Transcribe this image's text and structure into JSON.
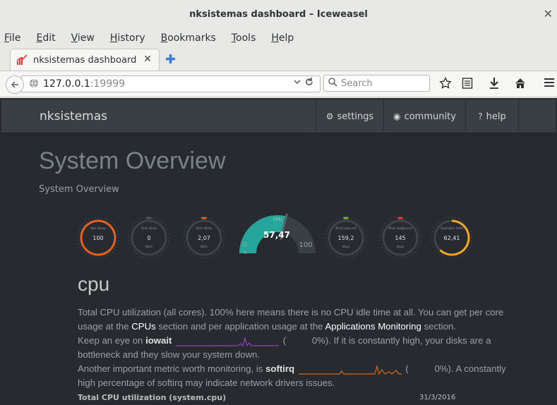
{
  "window": {
    "title": "nksistemas dashboard – Iceweasel",
    "close": "✕"
  },
  "menu": [
    "File",
    "Edit",
    "View",
    "History",
    "Bookmarks",
    "Tools",
    "Help"
  ],
  "tab": {
    "label": "nksistemas dashboard",
    "close": "✕",
    "new_tab": "✚"
  },
  "navbar": {
    "url_host": "127.0.0.1",
    "url_port": ":19999",
    "search_placeholder": "Search"
  },
  "site": {
    "brand": "nksistemas",
    "links": [
      {
        "icon": "⚙",
        "label": "settings"
      },
      {
        "icon": "◉",
        "label": "community"
      },
      {
        "icon": "?",
        "label": "help"
      }
    ]
  },
  "overview": {
    "title": "System Overview",
    "subtitle": "System Overview"
  },
  "gauges": {
    "small": [
      {
        "title": "Net Swap",
        "value": "100",
        "unit": "",
        "color": "#e8601c",
        "level": 1.0
      },
      {
        "title": "Disk Read",
        "value": "0",
        "unit": "KB/s",
        "color": "#555555",
        "level": 0.0
      },
      {
        "title": "Disk Write",
        "value": "2,07",
        "unit": "KB/s",
        "color": "#e8601c",
        "level": 0.03
      },
      {
        "title": "IPv4 Inbound",
        "value": "159,2",
        "unit": "kbps",
        "color": "#7cb342",
        "level": 0.05
      },
      {
        "title": "IPv4 Outbound",
        "value": "145",
        "unit": "kbps",
        "color": "#e53935",
        "level": 0.08
      },
      {
        "title": "Available RAM",
        "value": "62,41",
        "unit": "",
        "color": "#f5a623",
        "level": 0.62
      }
    ],
    "cpu": {
      "title": "CPU",
      "value": "57,47",
      "min": "0",
      "max": "100",
      "unit": "%",
      "color": "#26a69a",
      "level": 0.5747
    }
  },
  "cpu_section": {
    "title": "cpu",
    "p1": "Total CPU utilization (all cores). 100% here means there is no CPU idle time at all. You can get per core usage at the ",
    "link1": "CPUs",
    "p2": " section and per application usage at the ",
    "link2": "Applications Monitoring",
    "p3": " section.",
    "p4": "Keep an eye on ",
    "iowait": "iowait",
    "iowait_pct": "0%",
    "p5": "). If it is constantly high, your disks are a bottleneck and they slow your system down.",
    "p6": "Another important metric worth monitoring, is ",
    "softirq": "softirq",
    "softirq_pct": "0%",
    "p7": "). A constantly high percentage of softirq may indicate network drivers issues.",
    "chart_title": "Total CPU utilization (system.cpu)",
    "chart_date": "31/3/2016",
    "colors": {
      "iowait": "#8e44ad",
      "softirq": "#d2691e"
    }
  }
}
